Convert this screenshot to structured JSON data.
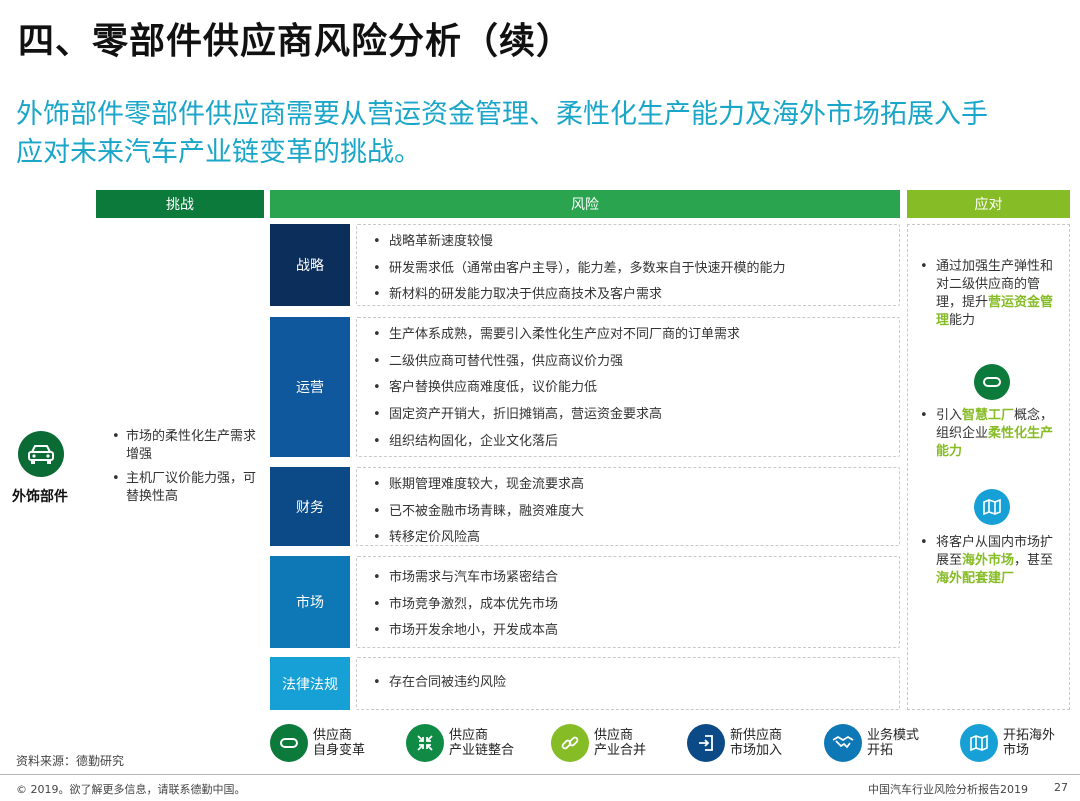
{
  "page_title": "四、零部件供应商风险分析（续）",
  "subtitle_line1": "外饰部件零部件供应商需要从营运资金管理、柔性化生产能力及海外市场拓展入手",
  "subtitle_line2": "应对未来汽车产业链变革的挑战。",
  "headers": {
    "challenge": "挑战",
    "risk": "风险",
    "response": "应对"
  },
  "colors": {
    "dark_green": "#0b7a3b",
    "mid_green": "#2aa44f",
    "light_green": "#86bc25",
    "teal_title": "#1aa6c8",
    "navy": "#0b2e5b",
    "blue": "#10589e",
    "dark_blue": "#0b4a86",
    "teal": "#0e78b6",
    "cyan": "#16a0d6"
  },
  "challenge": {
    "icon": "car-icon",
    "label": "外饰部件",
    "items": [
      "市场的柔性化生产需求增强",
      "主机厂议价能力强，可替换性高"
    ]
  },
  "risks": [
    {
      "category": "战略",
      "items": [
        "战略革新速度较慢",
        "研发需求低（通常由客户主导），能力差，多数来自于快速开模的能力",
        "新材料的研发能力取决于供应商技术及客户需求"
      ]
    },
    {
      "category": "运营",
      "items": [
        "生产体系成熟，需要引入柔性化生产应对不同厂商的订单需求",
        "二级供应商可替代性强，供应商议价力强",
        "客户替换供应商难度低，议价能力低",
        "固定资产开销大，折旧摊销高，营运资金要求高",
        "组织结构固化，企业文化落后"
      ]
    },
    {
      "category": "财务",
      "items": [
        "账期管理难度较大，现金流要求高",
        "已不被金融市场青睐，融资难度大",
        "转移定价风险高"
      ]
    },
    {
      "category": "市场",
      "items": [
        "市场需求与汽车市场紧密结合",
        "市场竞争激烈，成本优先市场",
        "市场开发余地小，开发成本高"
      ]
    },
    {
      "category": "法律法规",
      "items": [
        "存在合同被违约风险"
      ]
    }
  ],
  "responses": [
    {
      "icon": "loop-icon",
      "p1": "通过加强生产弹性和对二级供应商的管理，提升",
      "h1": "营运资金管理",
      "p2": "能力",
      "h2": ""
    },
    {
      "icon": "map-icon",
      "p1": "引入",
      "h1": "智慧工厂",
      "p2": "概念，组织企业",
      "h2": "柔性化生产能力"
    },
    {
      "icon": "",
      "p1": "将客户从国内市场扩展至",
      "h1": "海外市场",
      "p2": "，甚至",
      "h2": "海外配套建厂"
    }
  ],
  "legend": [
    {
      "icon": "loop-icon",
      "line1": "供应商",
      "line2": "自身变革"
    },
    {
      "icon": "merge-arrows-icon",
      "line1": "供应商",
      "line2": "产业链整合"
    },
    {
      "icon": "link-icon",
      "line1": "供应商",
      "line2": "产业合并"
    },
    {
      "icon": "enter-icon",
      "line1": "新供应商",
      "line2": "市场加入"
    },
    {
      "icon": "handshake-icon",
      "line1": "业务模式",
      "line2": "开拓"
    },
    {
      "icon": "map-icon",
      "line1": "开拓海外",
      "line2": "市场"
    }
  ],
  "source": "资料来源：德勤研究",
  "footer": {
    "copyright": "© 2019。欲了解更多信息，请联系德勤中国。",
    "report": "中国汽车行业风险分析报告2019",
    "page": "27"
  }
}
